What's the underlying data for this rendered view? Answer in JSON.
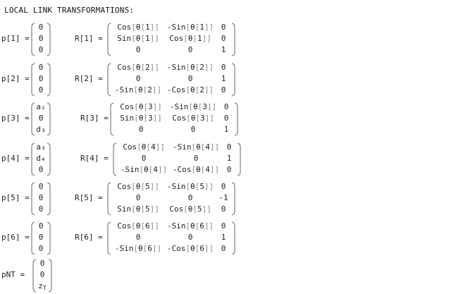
{
  "title": "LOCAL LINK TRANSFORMATIONS:",
  "rows": [
    {
      "p_label": "p[1] =",
      "p": [
        "0",
        "0",
        "0"
      ],
      "r_label": "R[1] =",
      "R": [
        [
          "Cos[θ[1]]",
          "-Sin[θ[1]]",
          "0"
        ],
        [
          "Sin[θ[1]]",
          "Cos[θ[1]]",
          "0"
        ],
        [
          "0",
          "0",
          "1"
        ]
      ]
    },
    {
      "p_label": "p[2] =",
      "p": [
        "0",
        "0",
        "0"
      ],
      "r_label": "R[2] =",
      "R": [
        [
          "Cos[θ[2]]",
          "-Sin[θ[2]]",
          "0"
        ],
        [
          "0",
          "0",
          "1"
        ],
        [
          "-Sin[θ[2]]",
          "-Cos[θ[2]]",
          "0"
        ]
      ]
    },
    {
      "p_label": "p[3] =",
      "p": [
        "a₂",
        "0",
        "d₃"
      ],
      "r_label": "R[3] =",
      "R": [
        [
          "Cos[θ[3]]",
          "-Sin[θ[3]]",
          "0"
        ],
        [
          "Sin[θ[3]]",
          "Cos[θ[3]]",
          "0"
        ],
        [
          "0",
          "0",
          "1"
        ]
      ]
    },
    {
      "p_label": "p[4] =",
      "p": [
        "a₃",
        "d₄",
        "0"
      ],
      "r_label": "R[4] =",
      "R": [
        [
          "Cos[θ[4]]",
          "-Sin[θ[4]]",
          "0"
        ],
        [
          "0",
          "0",
          "1"
        ],
        [
          "-Sin[θ[4]]",
          "-Cos[θ[4]]",
          "0"
        ]
      ]
    },
    {
      "p_label": "p[5] =",
      "p": [
        "0",
        "0",
        "0"
      ],
      "r_label": "R[5] =",
      "R": [
        [
          "Cos[θ[5]]",
          "-Sin[θ[5]]",
          "0"
        ],
        [
          "0",
          "0",
          "-1"
        ],
        [
          "Sin[θ[5]]",
          "Cos[θ[5]]",
          "0"
        ]
      ]
    },
    {
      "p_label": "p[6] =",
      "p": [
        "0",
        "0",
        "0"
      ],
      "r_label": "R[6] =",
      "R": [
        [
          "Cos[θ[6]]",
          "-Sin[θ[6]]",
          "0"
        ],
        [
          "0",
          "0",
          "1"
        ],
        [
          "-Sin[θ[6]]",
          "-Cos[θ[6]]",
          "0"
        ]
      ]
    }
  ],
  "pnt": {
    "label": "pNT =",
    "values": [
      "0",
      "0",
      "z_T"
    ]
  }
}
